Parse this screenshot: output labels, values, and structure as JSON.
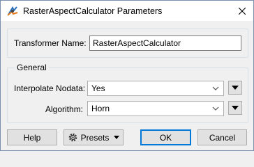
{
  "window": {
    "title": "RasterAspectCalculator Parameters"
  },
  "transformer": {
    "label": "Transformer Name:",
    "value": "RasterAspectCalculator"
  },
  "general": {
    "legend": "General",
    "interpolate_label": "Interpolate Nodata:",
    "interpolate_value": "Yes",
    "algorithm_label": "Algorithm:",
    "algorithm_value": "Horn"
  },
  "buttons": {
    "help": "Help",
    "presets": "Presets",
    "ok": "OK",
    "cancel": "Cancel"
  },
  "icons": {
    "app": "fme-transformer-icon",
    "close": "close-icon",
    "dropdown": "chevron-down-icon",
    "menu": "triangle-down-icon",
    "presets": "gear-icon"
  }
}
